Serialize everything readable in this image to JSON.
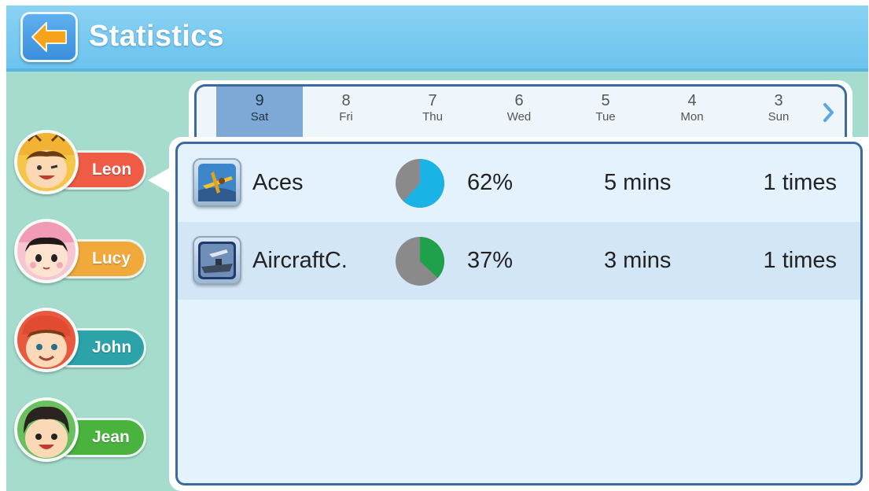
{
  "header": {
    "title": "Statistics",
    "back_icon": "arrow-left-icon"
  },
  "dates": [
    {
      "num": "9",
      "day": "Sat",
      "selected": true
    },
    {
      "num": "8",
      "day": "Fri"
    },
    {
      "num": "7",
      "day": "Thu"
    },
    {
      "num": "6",
      "day": "Wed"
    },
    {
      "num": "5",
      "day": "Tue"
    },
    {
      "num": "4",
      "day": "Mon"
    },
    {
      "num": "3",
      "day": "Sun"
    }
  ],
  "users": [
    {
      "name": "Leon",
      "color": "#ef5b45",
      "selected": true
    },
    {
      "name": "Lucy",
      "color": "#f0a93a"
    },
    {
      "name": "John",
      "color": "#2ba3a9"
    },
    {
      "name": "Jean",
      "color": "#49b33e"
    }
  ],
  "apps": [
    {
      "name": "Aces",
      "percent": "62%",
      "fraction": 0.62,
      "mins": "5 mins",
      "times": "1 times",
      "color": "#1ab3e6",
      "icon": "plane-game-icon"
    },
    {
      "name": "AircraftC.",
      "percent": "37%",
      "fraction": 0.37,
      "mins": "3 mins",
      "times": "1 times",
      "color": "#1fa04a",
      "icon": "aircraft-carrier-game-icon"
    }
  ]
}
